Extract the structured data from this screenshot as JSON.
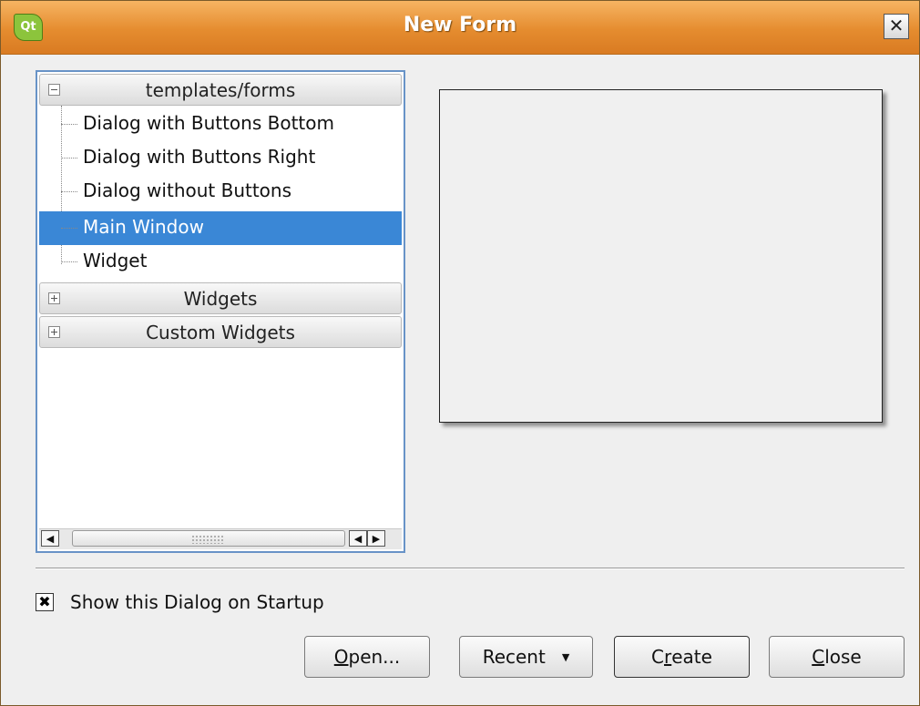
{
  "window": {
    "title": "New Form",
    "app_icon_text": "Qt",
    "close_glyph": "✕"
  },
  "tree": {
    "groups": [
      {
        "label": "templates/forms",
        "expanded": true,
        "items": [
          "Dialog with Buttons Bottom",
          "Dialog with Buttons Right",
          "Dialog without Buttons",
          "Main Window",
          "Widget"
        ],
        "selected": "Main Window"
      },
      {
        "label": "Widgets",
        "expanded": false
      },
      {
        "label": "Custom Widgets",
        "expanded": false
      }
    ],
    "scroll_left": "◀",
    "scroll_right": "▶"
  },
  "options": {
    "show_on_startup_label": "Show this Dialog on Startup",
    "show_on_startup_checked": true,
    "check_glyph": "✖"
  },
  "buttons": {
    "open": {
      "mnemonic": "O",
      "rest": "pen..."
    },
    "recent": {
      "label": "Recent",
      "arrow": "▼"
    },
    "create": {
      "pre": "C",
      "mnemonic": "r",
      "rest": "eate"
    },
    "close": {
      "mnemonic": "C",
      "rest": "lose"
    }
  },
  "colors": {
    "titlebar": "#e58c2f",
    "selection": "#3a87d6",
    "tree_border": "#6893c7"
  }
}
